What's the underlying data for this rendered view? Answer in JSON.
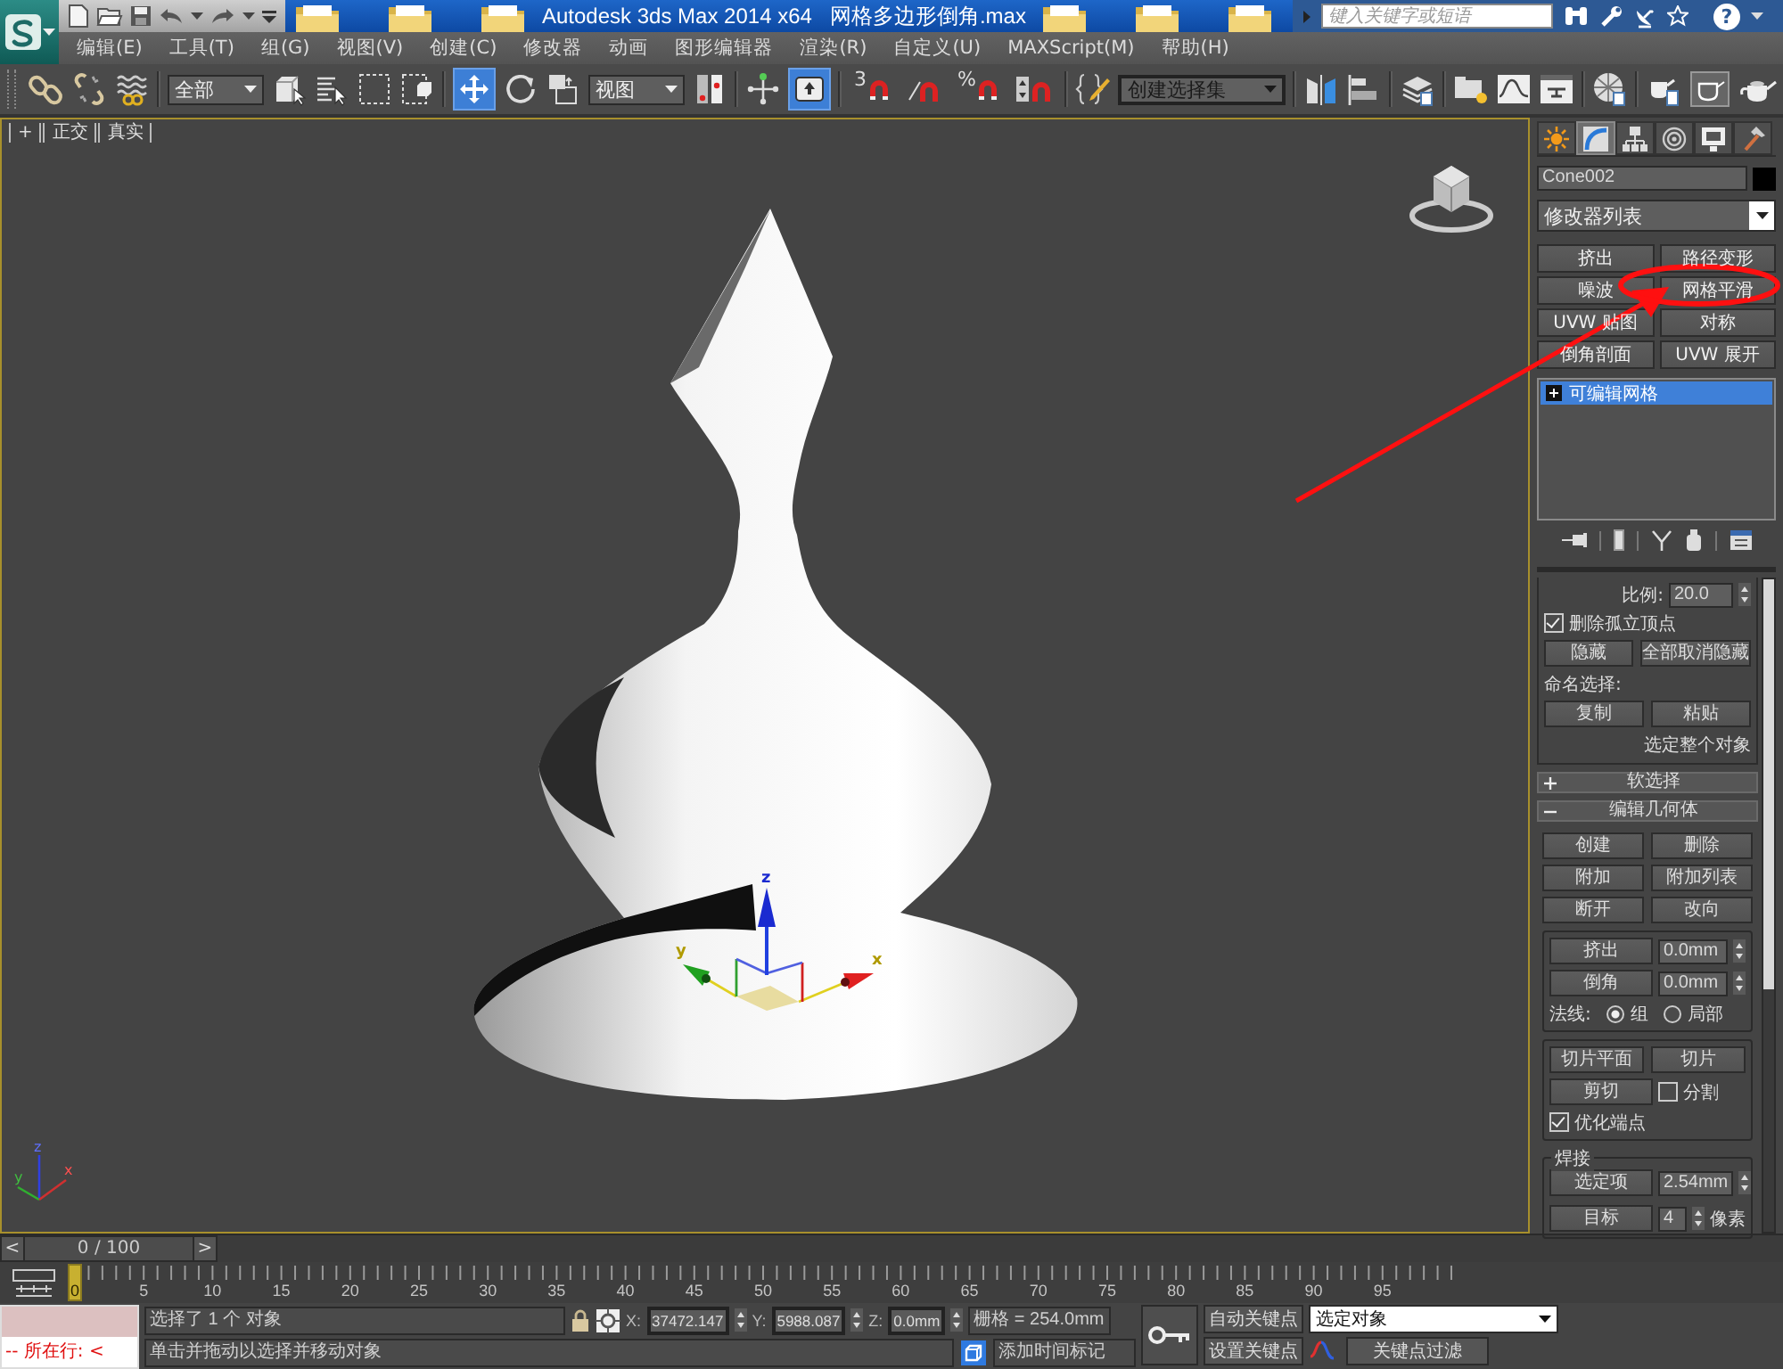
{
  "title_bar": {
    "app_title": "Autodesk 3ds Max  2014 x64",
    "file_name": "网格多边形倒角.max",
    "search_field": {
      "placeholder": "键入关键字或短语"
    },
    "help_button": "?"
  },
  "menu_bar": [
    "编辑(E)",
    "工具(T)",
    "组(G)",
    "视图(V)",
    "创建(C)",
    "修改器",
    "动画",
    "图形编辑器",
    "渲染(R)",
    "自定义(U)",
    "MAXScript(M)",
    "帮助(H)"
  ],
  "main_toolbar": {
    "selection_filter": "全部",
    "move_tool_selected": true,
    "reference_coordinate_system": "视图",
    "keyboard_override_on": true,
    "snap_toggle_label": "3",
    "percent_snap_label": "%",
    "named_selection_set": "创建选择集"
  },
  "viewport": {
    "active": true,
    "labels": [
      "+",
      "正交",
      "真实"
    ],
    "gizmo_axis_labels": [
      "z",
      "y",
      "x"
    ],
    "axis_tripod_labels": [
      "z",
      "y",
      "x"
    ]
  },
  "command_panel": {
    "tabs": [
      {
        "selected": false
      },
      {
        "selected": true
      },
      {
        "selected": false
      },
      {
        "selected": false
      },
      {
        "selected": false
      },
      {
        "selected": false
      }
    ],
    "object_name": "Cone002",
    "modifier_list": "修改器列表",
    "modifier_buttons": [
      "挤出",
      "路径变形",
      "噪波",
      "网格平滑",
      "UVW 贴图",
      "对称",
      "倒角剖面",
      "UVW 展开"
    ],
    "modifier_stack": [
      {
        "label": "可编辑网格",
        "selected": true,
        "expanded": false
      }
    ],
    "selection_rollout": {
      "scale": {
        "label": "比例:",
        "value": "20.0"
      },
      "delete_isolated_vertices": {
        "label": "删除孤立顶点",
        "checked": true
      },
      "visibility_buttons": [
        "隐藏",
        "全部取消隐藏"
      ],
      "named_selection": {
        "label": "命名选择:",
        "buttons": [
          "复制",
          "粘贴"
        ]
      },
      "info": "选定整个对象"
    },
    "rollouts": [
      {
        "label": "软选择",
        "expanded": false
      },
      {
        "label": "编辑几何体",
        "expanded": true
      }
    ],
    "edit_geometry": {
      "buttons": [
        "创建",
        "删除",
        "附加",
        "附加列表",
        "断开",
        "改向"
      ],
      "spinners": [
        {
          "label": "挤出",
          "value": "0.0mm"
        },
        {
          "label": "倒角",
          "value": "0.0mm"
        }
      ],
      "normals": {
        "label": "法线:",
        "options": [
          {
            "label": "组",
            "selected": true
          },
          {
            "label": "局部",
            "selected": false
          }
        ]
      },
      "slice_buttons": [
        "切片平面",
        "切片"
      ],
      "cut_button": "剪切",
      "split": {
        "label": "分割",
        "checked": false
      },
      "refine_ends": {
        "label": "优化端点",
        "checked": true
      },
      "weld": {
        "title": "焊接",
        "selected": {
          "label": "选定项",
          "value": "2.54mm"
        },
        "target": {
          "label": "目标",
          "value": "4",
          "unit": "像素"
        }
      }
    }
  },
  "time_slider": {
    "prev": "<",
    "position": "0 / 100",
    "next": ">",
    "level": 0
  },
  "track_bar": {
    "frame_labels": [
      "0",
      "5",
      "10",
      "15",
      "20",
      "25",
      "30",
      "35",
      "40",
      "45",
      "50",
      "55",
      "60",
      "65",
      "70",
      "75",
      "80",
      "85",
      "90",
      "95"
    ]
  },
  "status_bar": {
    "listener_output": "-- 所在行: <",
    "selection_info": "选择了 1 个 对象",
    "prompt": "单击并拖动以选择并移动对象",
    "coordinates": [
      {
        "axis": "X:",
        "value": "37472.147"
      },
      {
        "axis": "Y:",
        "value": "5988.087"
      },
      {
        "axis": "Z:",
        "value": "0.0mm"
      }
    ],
    "grid": "栅格 = 254.0mm",
    "add_time_tag": "添加时间标记",
    "auto_key": "自动关键点",
    "set_key": "设置关键点",
    "key_mode": "选定对象",
    "key_filters": "关键点过滤"
  }
}
